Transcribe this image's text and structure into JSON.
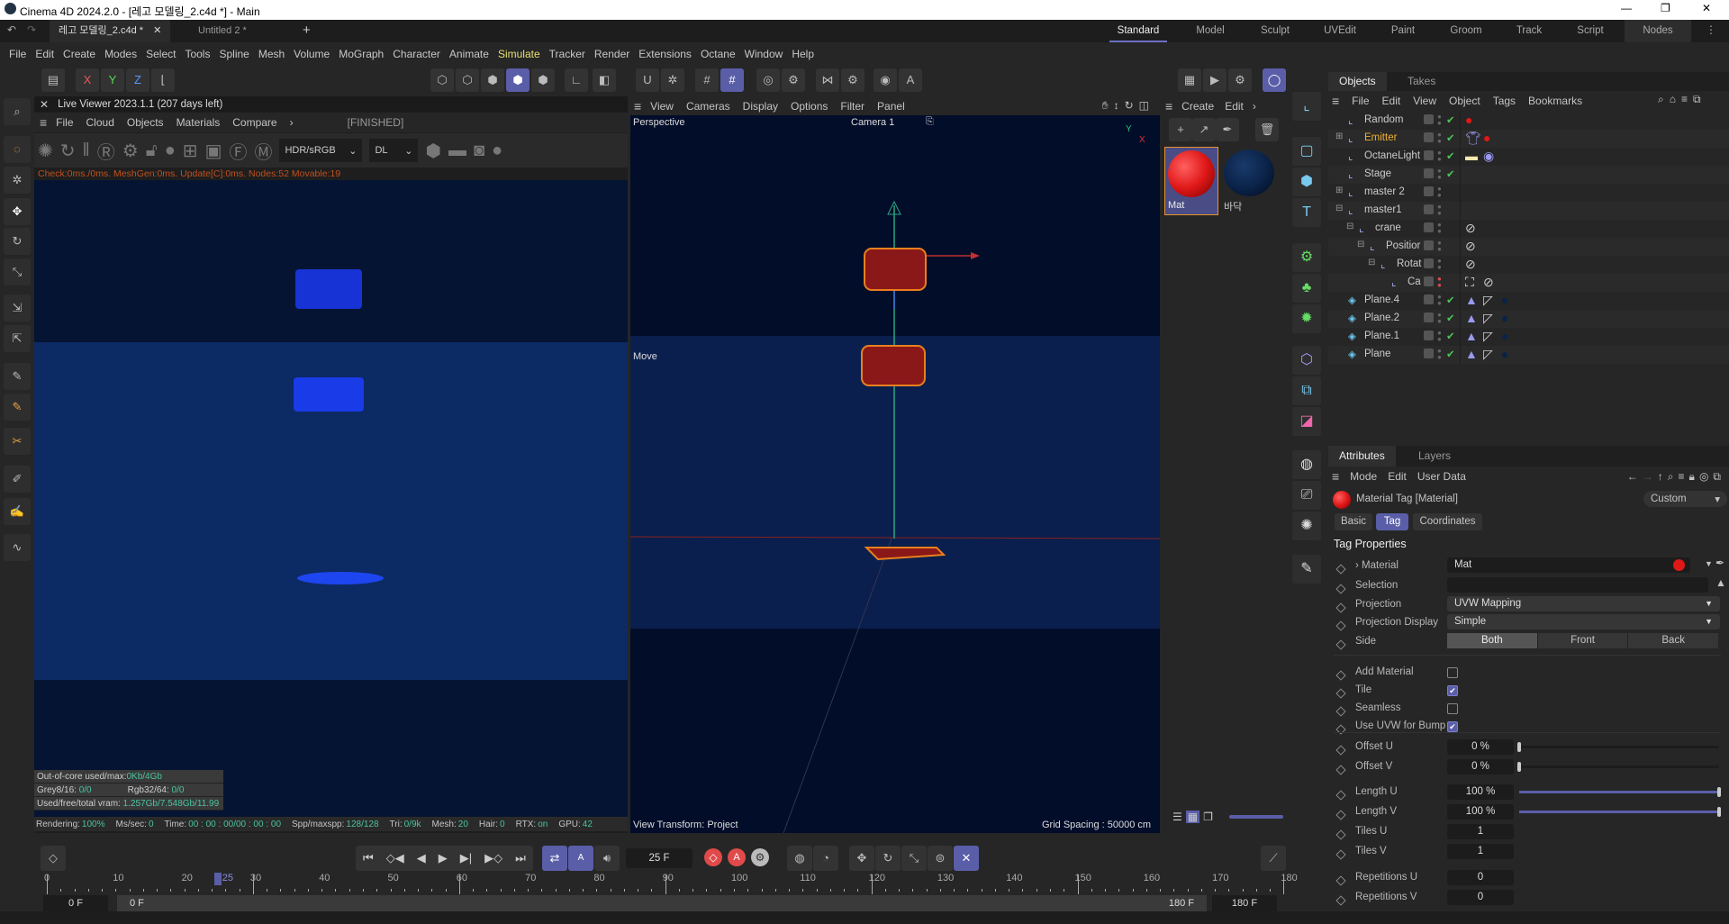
{
  "title": "Cinema 4D 2024.2.0 - [레고 모델링_2.c4d *] - Main",
  "doc_tabs": [
    "레고 모델링_2.c4d *",
    "Untitled 2 *"
  ],
  "layouts": [
    "Standard",
    "Model",
    "Sculpt",
    "UVEdit",
    "Paint",
    "Groom",
    "Track",
    "Script",
    "Nodes"
  ],
  "active_layout": "Standard",
  "menu": [
    "File",
    "Edit",
    "Create",
    "Modes",
    "Select",
    "Tools",
    "Spline",
    "Mesh",
    "Volume",
    "MoGraph",
    "Character",
    "Animate",
    "Simulate",
    "Tracker",
    "Render",
    "Extensions",
    "Octane",
    "Window",
    "Help"
  ],
  "axis_buttons": [
    "X",
    "Y",
    "Z"
  ],
  "live_viewer": {
    "title": "Live Viewer 2023.1.1 (207 days left)",
    "menu": [
      "File",
      "Cloud",
      "Objects",
      "Materials",
      "Compare"
    ],
    "status": "[FINISHED]",
    "color_mode": "HDR/sRGB",
    "kernel": "DL",
    "check_line": "Check:0ms./0ms. MeshGen:0ms. Update[C]:0ms. Nodes:52 Movable:19",
    "stats": {
      "ooc_label": "Out-of-core used/max:",
      "ooc_value": "0Kb/4Gb",
      "grey_label": "Grey8/16:",
      "grey_value": "0/0",
      "rgb_label": "Rgb32/64:",
      "rgb_value": "0/0",
      "vram_label": "Used/free/total vram:",
      "vram_value": "1.257Gb/7.548Gb/11.99"
    },
    "render_line": [
      {
        "label": "Rendering:",
        "value": "100%"
      },
      {
        "label": "Ms/sec:",
        "value": "0"
      },
      {
        "label": "Time:",
        "value": "00 : 00 : 00/00 : 00 : 00"
      },
      {
        "label": "Spp/maxspp:",
        "value": "128/128"
      },
      {
        "label": "Tri:",
        "value": "0/9k"
      },
      {
        "label": "Mesh:",
        "value": "20"
      },
      {
        "label": "Hair:",
        "value": "0"
      },
      {
        "label": "RTX:",
        "value": "on"
      },
      {
        "label": "GPU:",
        "value": "42"
      }
    ]
  },
  "viewport": {
    "menu": [
      "View",
      "Cameras",
      "Display",
      "Options",
      "Filter",
      "Panel"
    ],
    "view_name": "Perspective",
    "camera": "Camera 1",
    "tool_label": "Move",
    "view_transform": "View Transform: Project",
    "grid_spacing": "Grid Spacing : 50000 cm"
  },
  "material_manager": {
    "menu": [
      "Create",
      "Edit"
    ],
    "materials": [
      {
        "name": "Mat",
        "color": "#e01818",
        "selected": true
      },
      {
        "name": "바닥",
        "color": "#0a2247",
        "selected": false
      }
    ]
  },
  "objects_panel": {
    "tabs": [
      "Objects",
      "Takes"
    ],
    "menu": [
      "File",
      "Edit",
      "View",
      "Object",
      "Tags",
      "Bookmarks"
    ],
    "items": [
      {
        "name": "Random",
        "depth": 0,
        "expand": "",
        "enabled": true,
        "tags": [
          "red-material"
        ]
      },
      {
        "name": "Emitter",
        "depth": 0,
        "expand": "+",
        "enabled": true,
        "highlight": true,
        "tags": [
          "shirt",
          "red-material"
        ]
      },
      {
        "name": "OctaneLight",
        "depth": 0,
        "expand": "",
        "enabled": true,
        "tags": [
          "light",
          "target"
        ]
      },
      {
        "name": "Stage",
        "depth": 0,
        "expand": "",
        "enabled": true,
        "tags": []
      },
      {
        "name": "master 2",
        "depth": 0,
        "expand": "+",
        "enabled": null,
        "tags": []
      },
      {
        "name": "master1",
        "depth": 0,
        "expand": "-",
        "enabled": null,
        "tags": []
      },
      {
        "name": "crane",
        "depth": 1,
        "expand": "-",
        "enabled": null,
        "tags": [
          "prohibit"
        ]
      },
      {
        "name": "Positior",
        "depth": 2,
        "expand": "-",
        "enabled": null,
        "tags": [
          "prohibit"
        ]
      },
      {
        "name": "Rotat",
        "depth": 3,
        "expand": "-",
        "enabled": null,
        "tags": [
          "prohibit"
        ]
      },
      {
        "name": "Ca",
        "depth": 4,
        "expand": "",
        "enabled": null,
        "tags": [
          "target-focus",
          "prohibit"
        ]
      },
      {
        "name": "Plane.4",
        "depth": 0,
        "expand": "",
        "enabled": true,
        "tags": [
          "pyramid",
          "corner",
          "navy-material"
        ]
      },
      {
        "name": "Plane.2",
        "depth": 0,
        "expand": "",
        "enabled": true,
        "tags": [
          "pyramid",
          "corner",
          "navy-material"
        ]
      },
      {
        "name": "Plane.1",
        "depth": 0,
        "expand": "",
        "enabled": true,
        "tags": [
          "pyramid",
          "corner",
          "navy-material"
        ]
      },
      {
        "name": "Plane",
        "depth": 0,
        "expand": "",
        "enabled": true,
        "tags": [
          "pyramid",
          "corner",
          "navy-material"
        ]
      }
    ]
  },
  "attributes": {
    "tabs": [
      "Attributes",
      "Layers"
    ],
    "menu": [
      "Mode",
      "Edit",
      "User Data"
    ],
    "object_title": "Material Tag [Material]",
    "preset": "Custom",
    "subtabs": [
      "Basic",
      "Tag",
      "Coordinates"
    ],
    "active_subtab": "Tag",
    "section": "Tag Properties",
    "material": {
      "label": "Material",
      "value": "Mat"
    },
    "selection": {
      "label": "Selection",
      "value": ""
    },
    "projection": {
      "label": "Projection",
      "value": "UVW Mapping"
    },
    "projection_display": {
      "label": "Projection Display",
      "value": "Simple"
    },
    "side": {
      "label": "Side",
      "options": [
        "Both",
        "Front",
        "Back"
      ],
      "selected": "Both"
    },
    "checkboxes": [
      {
        "label": "Add Material",
        "checked": false
      },
      {
        "label": "Tile",
        "checked": true
      },
      {
        "label": "Seamless",
        "checked": false
      },
      {
        "label": "Use UVW for Bump",
        "checked": true
      }
    ],
    "numeric": [
      {
        "label": "Offset U",
        "value": "0 %",
        "slider": 0
      },
      {
        "label": "Offset V",
        "value": "0 %",
        "slider": 0
      },
      {
        "label": "Length U",
        "value": "100 %",
        "slider": 1
      },
      {
        "label": "Length V",
        "value": "100 %",
        "slider": 1
      },
      {
        "label": "Tiles U",
        "value": "1"
      },
      {
        "label": "Tiles V",
        "value": "1"
      },
      {
        "label": "Repetitions U",
        "value": "0"
      },
      {
        "label": "Repetitions V",
        "value": "0"
      }
    ]
  },
  "timeline": {
    "current_frame": "25 F",
    "current_frame_number": 25,
    "ruler_labels": [
      "0",
      "10",
      "20",
      "25",
      "30",
      "40",
      "50",
      "60",
      "70",
      "80",
      "90",
      "100",
      "110",
      "120",
      "130",
      "140",
      "150",
      "160",
      "170",
      "180"
    ],
    "start": "0 F",
    "range_start": "0 F",
    "range_end": "180 F",
    "end": "180 F"
  },
  "colors": {
    "accent": "#5a5ea8",
    "check": "#4ec25a",
    "highlight": "#f0b030",
    "mat_red": "#e01818",
    "mat_navy": "#0a2247"
  }
}
